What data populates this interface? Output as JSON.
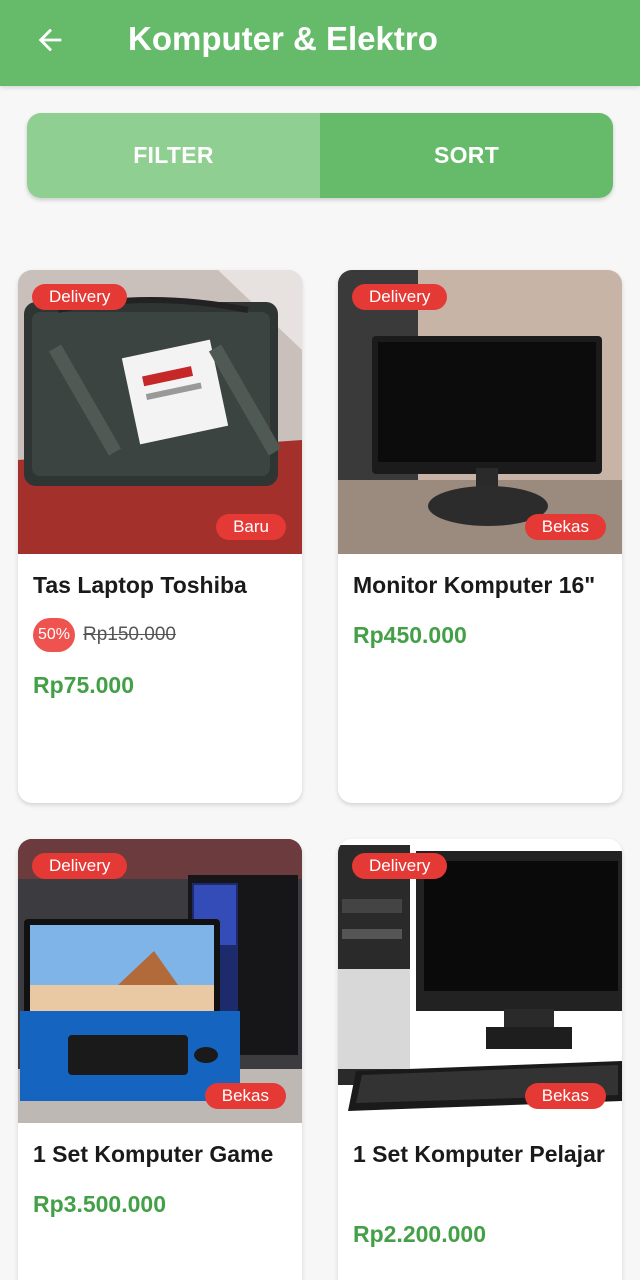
{
  "header": {
    "title": "Komputer & Elektro",
    "back_icon": "arrow-left-icon"
  },
  "toolbar": {
    "filter_label": "FILTER",
    "sort_label": "SORT"
  },
  "colors": {
    "primary": "#66bb6a",
    "primary_light": "#8fd092",
    "price": "#43a047",
    "badge": "#e53935"
  },
  "products": [
    {
      "title": "Tas Laptop Toshiba",
      "delivery": "Delivery",
      "condition": "Baru",
      "discount": "50%",
      "old_price": "Rp150.000",
      "price": "Rp75.000",
      "image_icon": "laptop-bag-image"
    },
    {
      "title": "Monitor Komputer 16\"",
      "delivery": "Delivery",
      "condition": "Bekas",
      "price": "Rp450.000",
      "image_icon": "monitor-image"
    },
    {
      "title": "1 Set Komputer Game",
      "delivery": "Delivery",
      "condition": "Bekas",
      "price": "Rp3.500.000",
      "image_icon": "gaming-pc-image"
    },
    {
      "title": "1 Set Komputer Pelajar",
      "delivery": "Delivery",
      "condition": "Bekas",
      "price": "Rp2.200.000",
      "image_icon": "desktop-pc-image"
    }
  ]
}
